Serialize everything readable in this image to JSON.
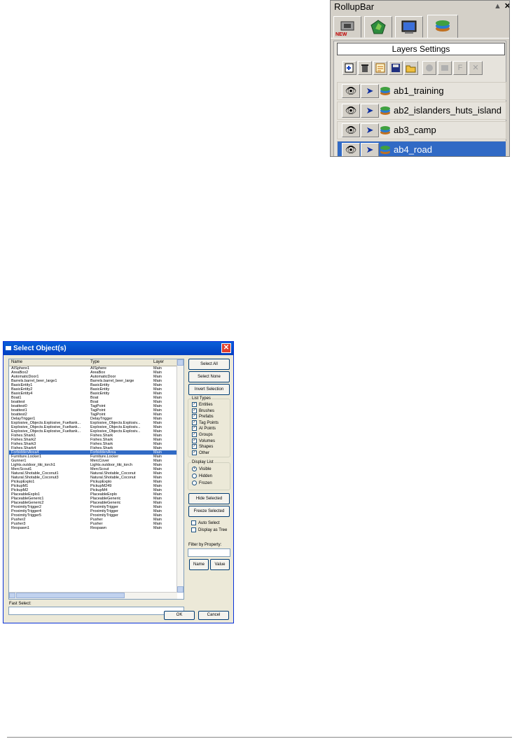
{
  "rollup": {
    "title": "RollupBar",
    "pin": "▲",
    "close": "✕",
    "tabs": [
      "new-objects-icon",
      "terrain-icon",
      "display-icon",
      "layers-icon"
    ],
    "panel_title": "Layers Settings",
    "toolbar": [
      {
        "name": "new-layer-icon",
        "glyph": "+",
        "enabled": true
      },
      {
        "name": "delete-layer-icon",
        "glyph": "🗑",
        "enabled": true
      },
      {
        "name": "layer-properties-icon",
        "glyph": "≡",
        "enabled": true
      },
      {
        "name": "save-layer-icon",
        "glyph": "▪",
        "enabled": true
      },
      {
        "name": "open-layer-icon",
        "glyph": "📂",
        "enabled": true
      },
      {
        "name": "freeze-icon",
        "glyph": "●",
        "enabled": false
      },
      {
        "name": "unfreeze-icon",
        "glyph": "■",
        "enabled": false
      },
      {
        "name": "f-icon",
        "glyph": "F",
        "enabled": false
      },
      {
        "name": "x-icon",
        "glyph": "✕",
        "enabled": false
      }
    ],
    "layers": [
      {
        "name": "ab1_training",
        "selected": false
      },
      {
        "name": "ab2_islanders_huts_island",
        "selected": false
      },
      {
        "name": "ab3_camp",
        "selected": false
      },
      {
        "name": "ab4_road",
        "selected": true
      }
    ]
  },
  "dialog": {
    "title": "Select Object(s)",
    "columns": [
      "Name",
      "Type",
      "Layer"
    ],
    "rows": [
      [
        "AISphere1",
        "AISphere",
        "Main"
      ],
      [
        "AreaBox2",
        "AreaBox",
        "Main"
      ],
      [
        "AutomaticDoor1",
        "AutomaticDoor",
        "Main"
      ],
      [
        "Barrels.barrel_beer_large1",
        "Barrels.barrel_beer_large",
        "Main"
      ],
      [
        "BasicEntity1",
        "BasicEntity",
        "Main"
      ],
      [
        "BasicEntity2",
        "BasicEntity",
        "Main"
      ],
      [
        "BasicEntity4",
        "BasicEntity",
        "Main"
      ],
      [
        "Boat1",
        "Boat",
        "Main"
      ],
      [
        "boattest",
        "Boat",
        "Main"
      ],
      [
        "boattest0",
        "TagPoint",
        "Main"
      ],
      [
        "boattest1",
        "TagPoint",
        "Main"
      ],
      [
        "boattest2",
        "TagPoint",
        "Main"
      ],
      [
        "DelayTrigger1",
        "DelayTrigger",
        "Main"
      ],
      [
        "Explosive_Objects.Explosive_Fueltank...",
        "Explosive_Objects.Explosiv...",
        "Main"
      ],
      [
        "Explosive_Objects.Explosive_Fueltank...",
        "Explosive_Objects.Explosiv...",
        "Main"
      ],
      [
        "Explosive_Objects.Explosive_Fueltank...",
        "Explosive_Objects.Explosiv...",
        "Main"
      ],
      [
        "Fishes.Shark1",
        "Fishes.Shark",
        "Main"
      ],
      [
        "Fishes.Shark2",
        "Fishes.Shark",
        "Main"
      ],
      [
        "Fishes.Shark3",
        "Fishes.Shark",
        "Main"
      ],
      [
        "Fishes.Shark4",
        "Fishes.Shark",
        "Main"
      ],
      [
        "ForbiddenArea4",
        "ForbiddenArea",
        "Main"
      ],
      [
        "Furniture.Locker1",
        "Furniture.Locker",
        "Main"
      ],
      [
        "Gunner1",
        "MercCover",
        "Main"
      ],
      [
        "Lights.outdoor_tiki_torch1",
        "Lights.outdoor_tiki_torch",
        "Main"
      ],
      [
        "MercScout1",
        "MercScout",
        "Main"
      ],
      [
        "Natural.Shotable_Coconut1",
        "Natural.Shotable_Coconut",
        "Main"
      ],
      [
        "Natural.Shotable_Coconut3",
        "Natural.Shotable_Coconut",
        "Main"
      ],
      [
        "PickupExplo1",
        "PickupExplo",
        "Main"
      ],
      [
        "PickupM1",
        "PickupM249",
        "Main"
      ],
      [
        "PickupM2",
        "PickupM4",
        "Main"
      ],
      [
        "PlaceableExplo1",
        "PlaceableExplo",
        "Main"
      ],
      [
        "PlaceableGeneric1",
        "PlaceableGeneric",
        "Main"
      ],
      [
        "PlaceableGeneric2",
        "PlaceableGeneric",
        "Main"
      ],
      [
        "ProximityTrigger2",
        "ProximityTrigger",
        "Main"
      ],
      [
        "ProximityTrigger4",
        "ProximityTrigger",
        "Main"
      ],
      [
        "ProximityTrigger5",
        "ProximityTrigger",
        "Main"
      ],
      [
        "Pusher2",
        "Pusher",
        "Main"
      ],
      [
        "Pusher3",
        "Pusher",
        "Main"
      ],
      [
        "Respawn1",
        "Respawn",
        "Main"
      ]
    ],
    "selected_row": 20,
    "buttons": {
      "select_all": "Select All",
      "select_none": "Select None",
      "invert": "Invert Selection",
      "hide": "Hide Selected",
      "freeze": "Freeze Selected",
      "name": "Name",
      "value": "Value",
      "ok": "OK",
      "cancel": "Cancel"
    },
    "list_types_label": "List Types",
    "list_types": [
      {
        "label": "Entities",
        "checked": true
      },
      {
        "label": "Brushes",
        "checked": true
      },
      {
        "label": "Prefabs",
        "checked": true
      },
      {
        "label": "Tag Points",
        "checked": true
      },
      {
        "label": "AI Points",
        "checked": true
      },
      {
        "label": "Groups",
        "checked": true
      },
      {
        "label": "Volumes",
        "checked": true
      },
      {
        "label": "Shapes",
        "checked": true
      },
      {
        "label": "Other",
        "checked": true
      }
    ],
    "display_list_label": "Display List",
    "display_list": [
      {
        "label": "Visible",
        "checked": true
      },
      {
        "label": "Hidden",
        "checked": false
      },
      {
        "label": "Frozen",
        "checked": false
      }
    ],
    "auto_select": "Auto Select",
    "display_as_tree": "Display as Tree",
    "filter_label": "Filter by Property:",
    "fast_select_label": "Fast Select:",
    "filter_value": "",
    "fast_select_value": ""
  }
}
